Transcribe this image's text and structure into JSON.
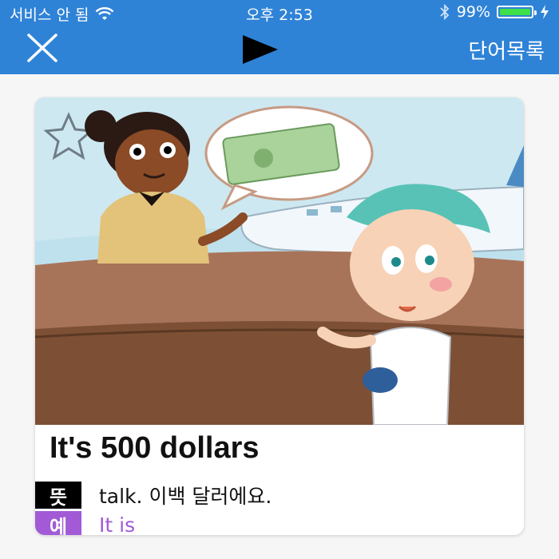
{
  "status_bar": {
    "carrier": "서비스 안 됨",
    "time": "오후 2:53",
    "battery_percent": "99%",
    "battery_level": 0.99,
    "icons": [
      "wifi-icon",
      "bluetooth-icon",
      "battery-icon",
      "charging-bolt-icon"
    ]
  },
  "nav": {
    "close_icon": "close-icon",
    "play_icon": "play-icon",
    "word_list_label": "단어목록"
  },
  "card": {
    "phrase": "It's 500 dollars",
    "meaning_tag": "뜻",
    "meaning_text": "talk. 이백 달러에요.",
    "example_tag": "예",
    "example_text": "It is"
  },
  "colors": {
    "header": "#2f83d7",
    "meaning_tag": "#000000",
    "example_tag": "#a25ad6",
    "example_text": "#a25ad6"
  }
}
